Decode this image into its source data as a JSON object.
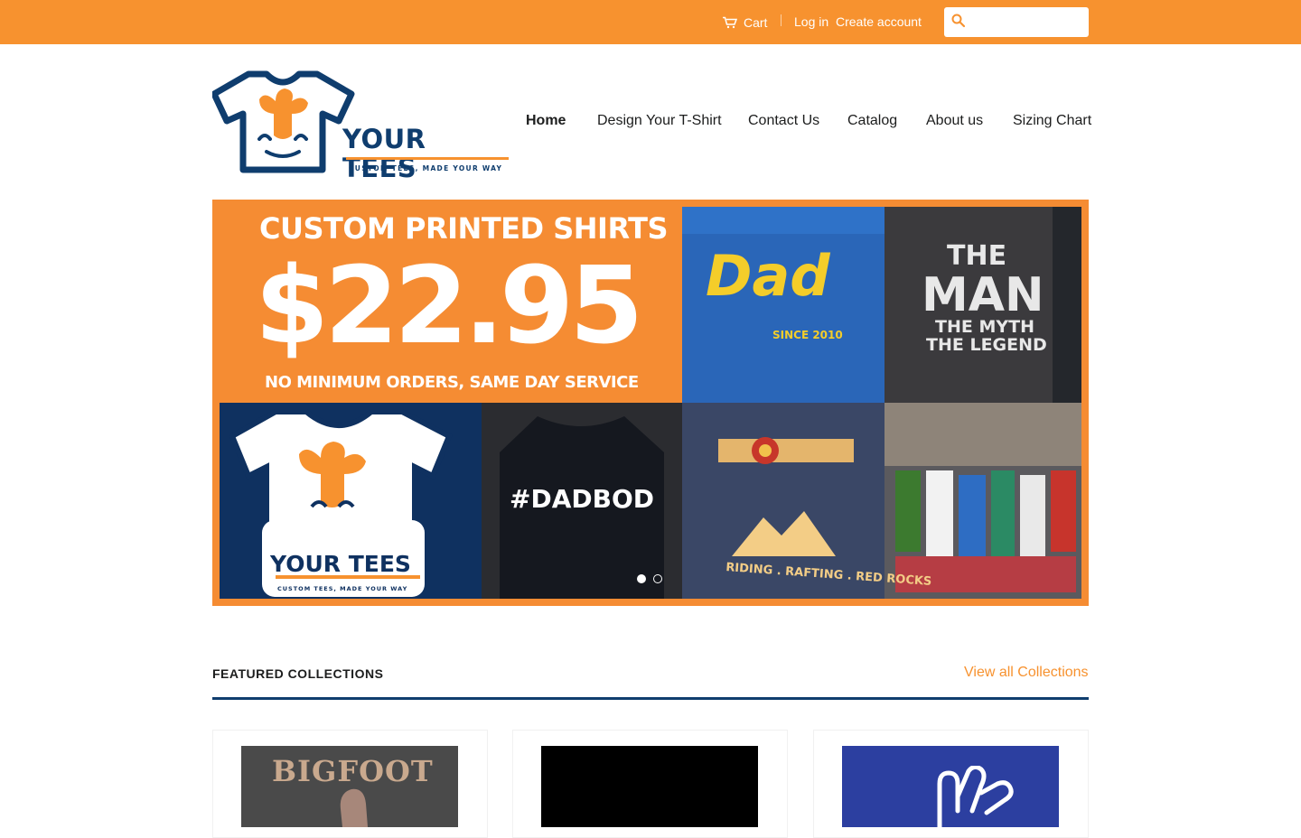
{
  "topbar": {
    "cart_label": "Cart",
    "login_label": "Log in",
    "create_account_label": "Create account",
    "search_placeholder": ""
  },
  "brand": {
    "name": "YOUR TEES",
    "tagline": "CUSTOM TEES, MADE YOUR WAY",
    "colors": {
      "orange": "#f7922f",
      "navy": "#0f3d6e"
    }
  },
  "nav": {
    "items": [
      {
        "label": "Home",
        "active": true
      },
      {
        "label": "Design Your T-Shirt"
      },
      {
        "label": "Contact Us"
      },
      {
        "label": "Catalog"
      },
      {
        "label": "About us"
      },
      {
        "label": "Sizing Chart"
      }
    ]
  },
  "hero": {
    "title": "CUSTOM PRINTED SHIRTS",
    "price": "$22.95",
    "subtitle": "NO MINIMUM ORDERS, SAME DAY SERVICE",
    "panels": {
      "dad_shirt": "Dad",
      "dad_since": "SINCE 2010",
      "man_line1": "THE",
      "man_line2": "MAN",
      "man_line3": "THE MYTH",
      "man_line4": "THE LEGEND",
      "dadbod": "#DADBOD",
      "colorado": "RIDING . RAFTING . RED ROCKS",
      "logo_name": "YOUR TEES",
      "logo_tagline": "CUSTOM TEES, MADE YOUR WAY"
    },
    "slide_count": 2,
    "active_slide": 1
  },
  "featured": {
    "title": "FEATURED COLLECTIONS",
    "view_all_label": "View all Collections",
    "collections": [
      {
        "image_text": "BIGFOOT"
      },
      {
        "image_text": ""
      },
      {
        "image_text": ""
      }
    ]
  }
}
